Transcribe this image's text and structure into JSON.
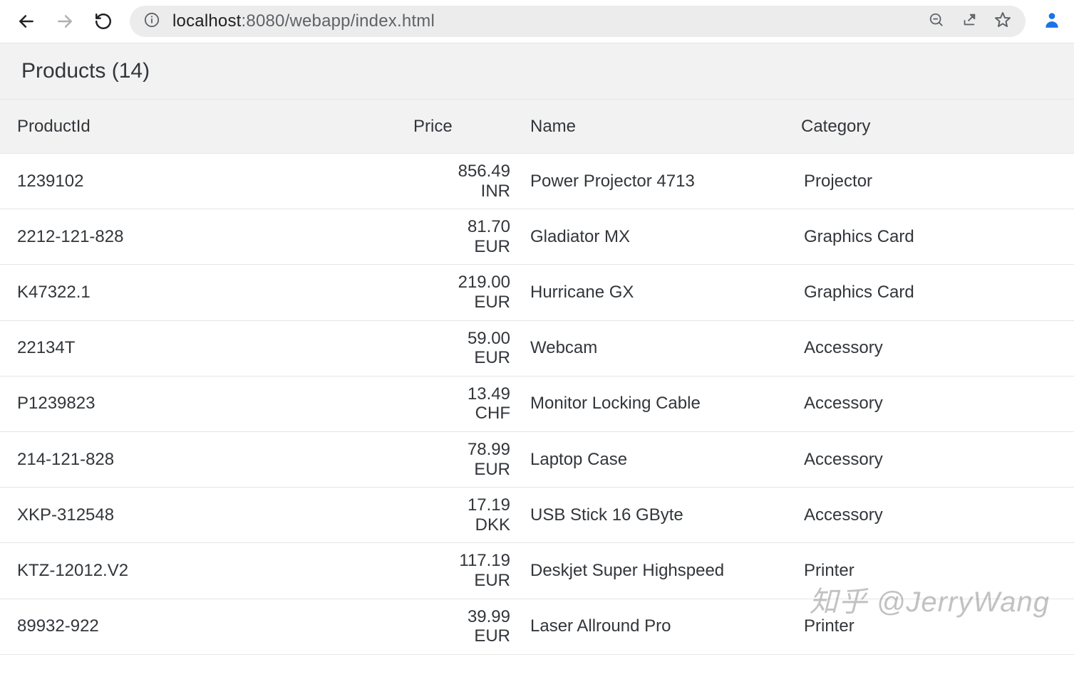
{
  "browser": {
    "url_host": "localhost",
    "url_port": ":8080",
    "url_path": "/webapp/index.html"
  },
  "header": {
    "title": "Products (14)"
  },
  "columns": {
    "productId": "ProductId",
    "price": "Price",
    "name": "Name",
    "category": "Category"
  },
  "rows": [
    {
      "id": "1239102",
      "price": "856.49\nINR",
      "name": "Power Projector 4713",
      "category": "Projector"
    },
    {
      "id": "2212-121-828",
      "price": "81.70\nEUR",
      "name": "Gladiator MX",
      "category": "Graphics Card"
    },
    {
      "id": "K47322.1",
      "price": "219.00\nEUR",
      "name": "Hurricane GX",
      "category": "Graphics Card"
    },
    {
      "id": "22134T",
      "price": "59.00\nEUR",
      "name": "Webcam",
      "category": "Accessory"
    },
    {
      "id": "P1239823",
      "price": "13.49\nCHF",
      "name": "Monitor Locking Cable",
      "category": "Accessory"
    },
    {
      "id": "214-121-828",
      "price": "78.99\nEUR",
      "name": "Laptop Case",
      "category": "Accessory"
    },
    {
      "id": "XKP-312548",
      "price": "17.19\nDKK",
      "name": "USB Stick 16 GByte",
      "category": "Accessory"
    },
    {
      "id": "KTZ-12012.V2",
      "price": "117.19\nEUR",
      "name": "Deskjet Super Highspeed",
      "category": "Printer"
    },
    {
      "id": "89932-922",
      "price": "39.99\nEUR",
      "name": "Laser Allround Pro",
      "category": "Printer"
    }
  ],
  "watermark": "知乎 @JerryWang"
}
